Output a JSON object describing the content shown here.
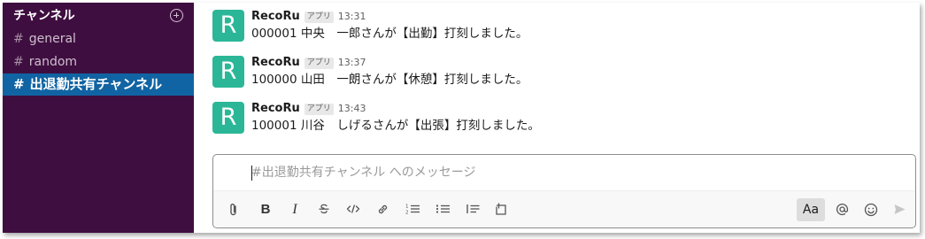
{
  "sidebar": {
    "header": "チャンネル",
    "channels": [
      {
        "hash": "#",
        "name": "general"
      },
      {
        "hash": "#",
        "name": "random"
      },
      {
        "hash": "#",
        "name": "出退勤共有チャンネル"
      }
    ]
  },
  "messages": [
    {
      "avatar_letter": "R",
      "sender": "RecoRu",
      "badge": "アプリ",
      "time": "13:31",
      "text": "000001 中央　一郎さんが【出勤】打刻しました。"
    },
    {
      "avatar_letter": "R",
      "sender": "RecoRu",
      "badge": "アプリ",
      "time": "13:37",
      "text": "100000 山田　一朗さんが【休憩】打刻しました。"
    },
    {
      "avatar_letter": "R",
      "sender": "RecoRu",
      "badge": "アプリ",
      "time": "13:43",
      "text": "100001 川谷　しげるさんが【出張】打刻しました。"
    }
  ],
  "composer": {
    "placeholder": "#出退勤共有チャンネル へのメッセージ",
    "toolbar": {
      "bold": "B",
      "italic": "I",
      "text_format": "Aa"
    }
  },
  "colors": {
    "sidebar_bg": "#3f0e40",
    "selected_channel_bg": "#1164a3",
    "avatar_bg": "#2bb797"
  }
}
